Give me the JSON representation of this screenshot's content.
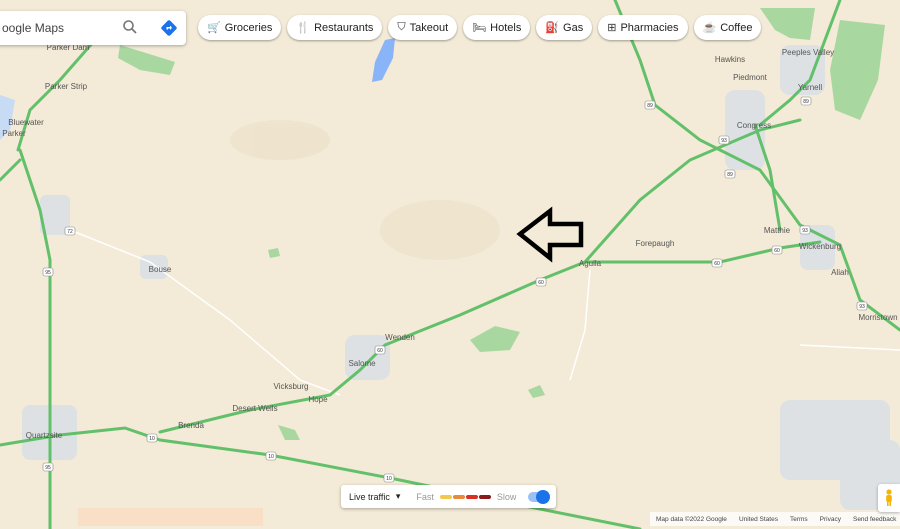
{
  "search": {
    "placeholder": "Search Google Maps",
    "value": "oogle Maps"
  },
  "chips": [
    {
      "icon": "cart-icon",
      "glyph": "🛒",
      "label": "Groceries"
    },
    {
      "icon": "fork-knife-icon",
      "glyph": "🍴",
      "label": "Restaurants"
    },
    {
      "icon": "takeout-icon",
      "glyph": "⛉",
      "label": "Takeout"
    },
    {
      "icon": "bed-icon",
      "glyph": "🛏",
      "label": "Hotels"
    },
    {
      "icon": "gas-pump-icon",
      "glyph": "⛽",
      "label": "Gas"
    },
    {
      "icon": "pharmacy-icon",
      "glyph": "⊞",
      "label": "Pharmacies"
    },
    {
      "icon": "coffee-icon",
      "glyph": "☕",
      "label": "Coffee"
    }
  ],
  "places": {
    "parker_dam": "Parker Dam",
    "parker_strip": "Parker Strip",
    "bluewater": "Bluewater",
    "parker": "Parker",
    "bouse": "Bouse",
    "vicksburg": "Vicksburg",
    "hope": "Hope",
    "desert_wells": "Desert Wells",
    "brenda": "Brenda",
    "quartzsite": "Quartzsite",
    "salome": "Salome",
    "wenden": "Wenden",
    "aguila": "Aguila",
    "forepaugh": "Forepaugh",
    "matthie": "Matthie",
    "wickenburg": "Wickenburg",
    "congress": "Congress",
    "hawkins": "Hawkins",
    "peeples_valley": "Peeples Valley",
    "yarnell": "Yarnell",
    "piedmont": "Piedmont",
    "morristown": "Morristown",
    "aliah": "Aliah"
  },
  "shields": {
    "s72": "72",
    "s95a": "95",
    "s95b": "95",
    "s60a": "60",
    "s60b": "60",
    "s60c": "60",
    "s60d": "60",
    "s93a": "93",
    "s93b": "93",
    "s89a": "89",
    "s89b": "89",
    "s89c": "89",
    "s93c": "93",
    "s10a": "10",
    "s10b": "10",
    "s10c": "10"
  },
  "traffic": {
    "label": "Live traffic",
    "fast": "Fast",
    "slow": "Slow",
    "scale_colors": [
      "#f2c94c",
      "#e8893c",
      "#d93025",
      "#8b1a1a"
    ]
  },
  "attribution": {
    "copyright": "Map data ©2022 Google",
    "country": "United States",
    "terms": "Terms",
    "privacy": "Privacy",
    "feedback": "Send feedback"
  },
  "colors": {
    "land": "#f3ead7",
    "road_green": "#63c06a",
    "town": "#dfe3e6",
    "park": "#a8d8a0",
    "water": "#8ab4f8",
    "accent": "#1a73e8"
  }
}
